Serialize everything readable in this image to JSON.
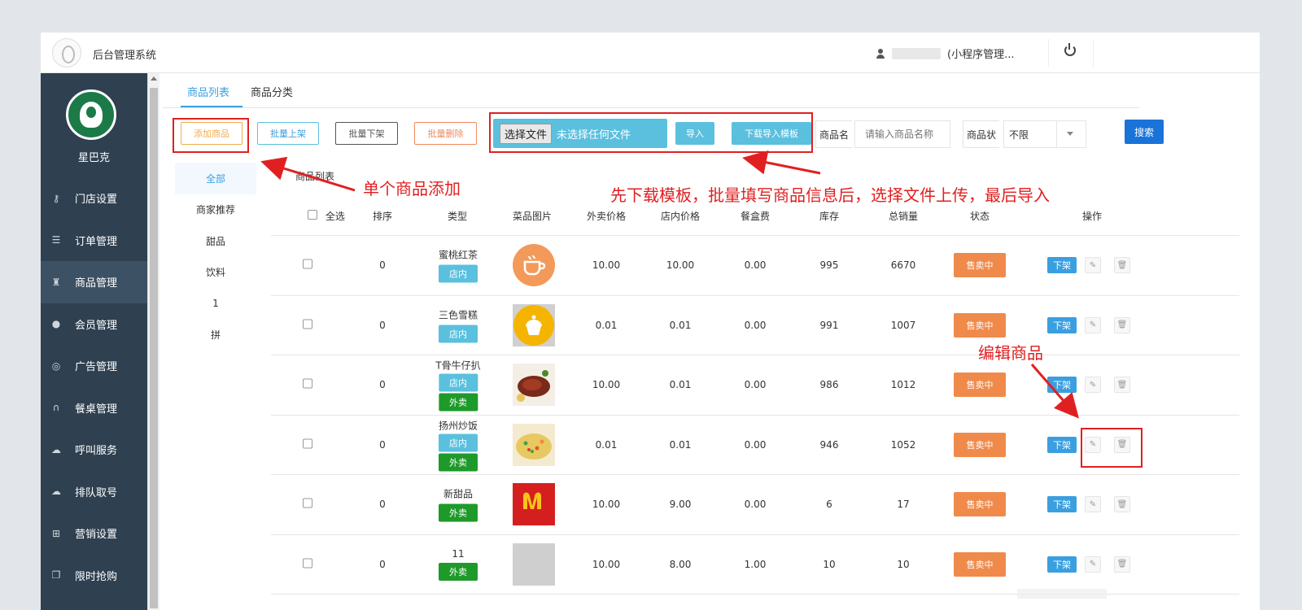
{
  "header": {
    "system_title": "后台管理系统",
    "user_label": "(小程序管理..."
  },
  "sidebar": {
    "brand_name": "星巴克",
    "items": [
      {
        "label": "门店设置",
        "icon": "key-icon",
        "active": false
      },
      {
        "label": "订单管理",
        "icon": "list-icon",
        "active": false
      },
      {
        "label": "商品管理",
        "icon": "trophy-icon",
        "active": true
      },
      {
        "label": "会员管理",
        "icon": "user-icon",
        "active": false
      },
      {
        "label": "广告管理",
        "icon": "lifebuoy-icon",
        "active": false
      },
      {
        "label": "餐桌管理",
        "icon": "binoculars-icon",
        "active": false
      },
      {
        "label": "呼叫服务",
        "icon": "cloud-icon",
        "active": false
      },
      {
        "label": "排队取号",
        "icon": "cloud-icon",
        "active": false
      },
      {
        "label": "营销设置",
        "icon": "gift-icon",
        "active": false
      },
      {
        "label": "限时抢购",
        "icon": "copy-icon",
        "active": false
      }
    ]
  },
  "tabs": [
    {
      "label": "商品列表",
      "active": true
    },
    {
      "label": "商品分类",
      "active": false
    }
  ],
  "toolbar": {
    "add_label": "添加商品",
    "batch_up_label": "批量上架",
    "batch_down_label": "批量下架",
    "batch_delete_label": "批量删除",
    "file_choose_label": "选择文件",
    "file_status": "未选择任何文件",
    "import_label": "导入",
    "download_template_label": "下载导入模板",
    "name_label": "商品名",
    "name_placeholder": "请输入商品名称",
    "status_label": "商品状",
    "status_value": "不限",
    "search_label": "搜索"
  },
  "categories": [
    {
      "label": "全部",
      "active": true
    },
    {
      "label": "商家推荐",
      "active": false
    },
    {
      "label": "甜品",
      "active": false
    },
    {
      "label": "饮料",
      "active": false
    },
    {
      "label": "1",
      "active": false
    },
    {
      "label": "拼",
      "active": false
    }
  ],
  "table": {
    "caption": "商品列表",
    "select_all": "全选",
    "columns": [
      "排序",
      "类型",
      "菜品图片",
      "外卖价格",
      "店内价格",
      "餐盒费",
      "库存",
      "总销量",
      "状态",
      "操作"
    ],
    "rows": [
      {
        "sort": "0",
        "name": "蜜桃红茶",
        "tags": [
          "店内"
        ],
        "image": "coffee-cup-icon",
        "takeout_price": "10.00",
        "dinein_price": "10.00",
        "box_fee": "0.00",
        "stock": "995",
        "sales": "6670",
        "status": "售卖中",
        "action": "下架"
      },
      {
        "sort": "0",
        "name": "三色雪糕",
        "tags": [
          "店内"
        ],
        "image": "cupcake-icon",
        "takeout_price": "0.01",
        "dinein_price": "0.01",
        "box_fee": "0.00",
        "stock": "991",
        "sales": "1007",
        "status": "售卖中",
        "action": "下架"
      },
      {
        "sort": "0",
        "name": "T骨牛仔扒",
        "tags": [
          "店内",
          "外卖"
        ],
        "image": "steak-photo",
        "takeout_price": "10.00",
        "dinein_price": "0.01",
        "box_fee": "0.00",
        "stock": "986",
        "sales": "1012",
        "status": "售卖中",
        "action": "下架"
      },
      {
        "sort": "0",
        "name": "扬州炒饭",
        "tags": [
          "店内",
          "外卖"
        ],
        "image": "fried-rice-photo",
        "takeout_price": "0.01",
        "dinein_price": "0.01",
        "box_fee": "0.00",
        "stock": "946",
        "sales": "1052",
        "status": "售卖中",
        "action": "下架"
      },
      {
        "sort": "0",
        "name": "新甜品",
        "tags": [
          "外卖"
        ],
        "image": "mcdonalds-logo",
        "takeout_price": "10.00",
        "dinein_price": "9.00",
        "box_fee": "0.00",
        "stock": "6",
        "sales": "17",
        "status": "售卖中",
        "action": "下架"
      },
      {
        "sort": "0",
        "name": "11",
        "tags": [
          "外卖"
        ],
        "image": "placeholder-image",
        "takeout_price": "10.00",
        "dinein_price": "8.00",
        "box_fee": "1.00",
        "stock": "10",
        "sales": "10",
        "status": "售卖中",
        "action": "下架"
      }
    ]
  },
  "annotations": {
    "add_single": "单个商品添加",
    "batch_import": "先下载模板，批量填写商品信息后，选择文件上传，最后导入",
    "edit": "编辑商品"
  },
  "colors": {
    "sidebar_bg": "#2f4050",
    "accent_blue": "#3a9fe0",
    "status_orange": "#f08a4b",
    "tag_green": "#1e9a2a",
    "annotation_red": "#e02020"
  }
}
